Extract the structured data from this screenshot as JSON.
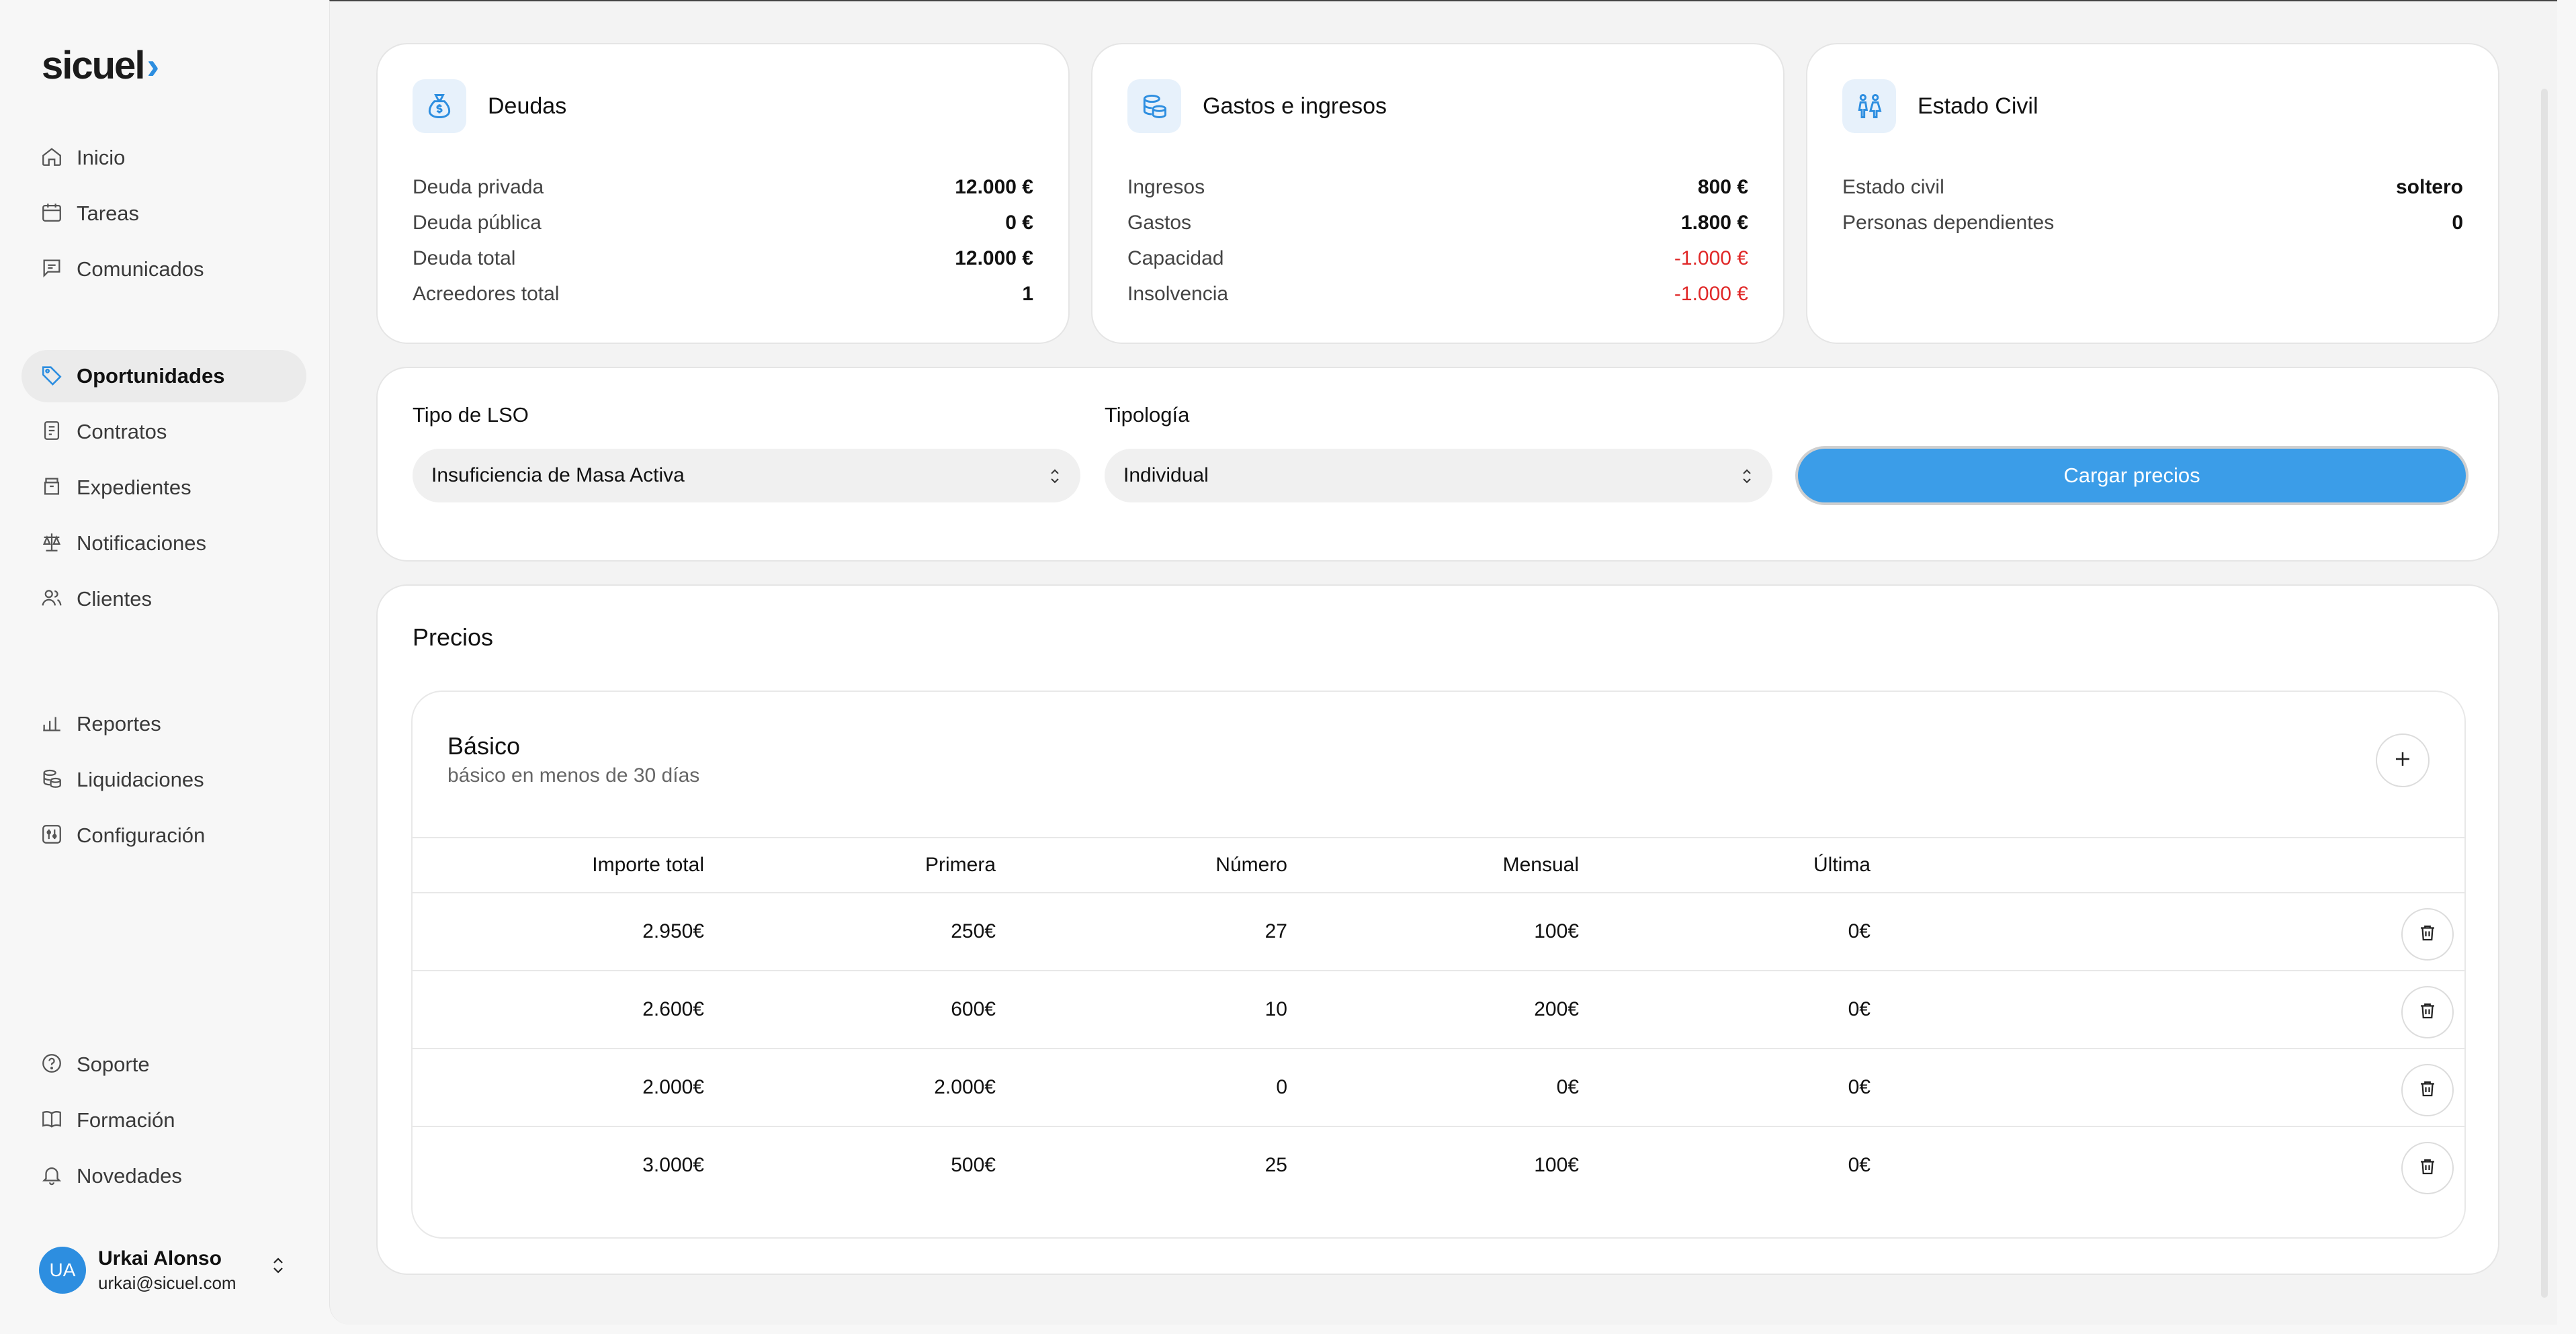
{
  "brand": {
    "name": "sicuel",
    "mark": "›"
  },
  "sidebar": {
    "items": [
      {
        "label": "Inicio",
        "icon": "home-icon"
      },
      {
        "label": "Tareas",
        "icon": "calendar-icon"
      },
      {
        "label": "Comunicados",
        "icon": "message-icon"
      },
      {
        "label": "Oportunidades",
        "icon": "tag-icon",
        "active": true
      },
      {
        "label": "Contratos",
        "icon": "contract-icon"
      },
      {
        "label": "Expedientes",
        "icon": "archive-icon"
      },
      {
        "label": "Notificaciones",
        "icon": "scale-icon"
      },
      {
        "label": "Clientes",
        "icon": "users-icon"
      },
      {
        "label": "Reportes",
        "icon": "bar-chart-icon"
      },
      {
        "label": "Liquidaciones",
        "icon": "coins-icon"
      },
      {
        "label": "Configuración",
        "icon": "settings-icon"
      },
      {
        "label": "Soporte",
        "icon": "help-icon"
      },
      {
        "label": "Formación",
        "icon": "book-icon"
      },
      {
        "label": "Novedades",
        "icon": "bell-icon"
      }
    ]
  },
  "user": {
    "initials": "UA",
    "name": "Urkai Alonso",
    "email": "urkai@sicuel.com"
  },
  "debts": {
    "title": "Deudas",
    "rows": [
      {
        "label": "Deuda privada",
        "value": "12.000 €"
      },
      {
        "label": "Deuda pública",
        "value": "0 €"
      },
      {
        "label": "Deuda total",
        "value": "12.000 €"
      },
      {
        "label": "Acreedores total",
        "value": "1"
      }
    ]
  },
  "finances": {
    "title": "Gastos e ingresos",
    "rows": [
      {
        "label": "Ingresos",
        "value": "800 €"
      },
      {
        "label": "Gastos",
        "value": "1.800 €"
      },
      {
        "label": "Capacidad",
        "value": "-1.000 €"
      },
      {
        "label": "Insolvencia",
        "value": "-1.000 €"
      }
    ]
  },
  "civil": {
    "title": "Estado Civil",
    "rows": [
      {
        "label": "Estado civil",
        "value": "soltero"
      },
      {
        "label": "Personas dependientes",
        "value": "0"
      }
    ]
  },
  "form": {
    "lso_label": "Tipo de LSO",
    "lso_value": "Insuficiencia de Masa Activa",
    "typology_label": "Tipología",
    "typology_value": "Individual",
    "load_button": "Cargar precios"
  },
  "prices": {
    "title": "Precios",
    "plan": {
      "name": "Básico",
      "description": "básico en menos de 30 días",
      "columns": [
        "Importe total",
        "Primera",
        "Número",
        "Mensual",
        "Última"
      ],
      "rows": [
        [
          "2.950€",
          "250€",
          "27",
          "100€",
          "0€"
        ],
        [
          "2.600€",
          "600€",
          "10",
          "200€",
          "0€"
        ],
        [
          "2.000€",
          "2.000€",
          "0",
          "0€",
          "0€"
        ],
        [
          "3.000€",
          "500€",
          "25",
          "100€",
          "0€"
        ]
      ]
    }
  },
  "colors": {
    "accent": "#3b9de8",
    "negative": "#e02828",
    "icon_bg": "#e7f1fb"
  }
}
